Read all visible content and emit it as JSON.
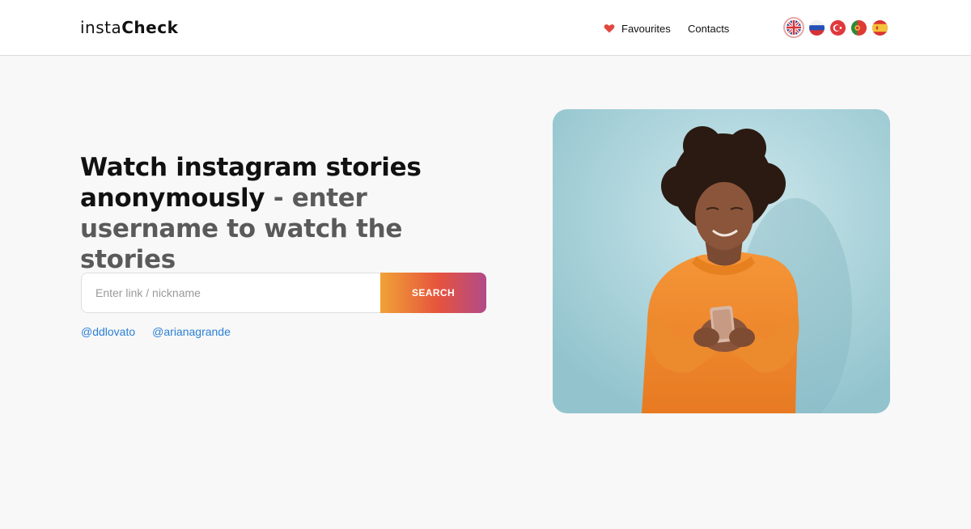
{
  "header": {
    "logo_light": "insta",
    "logo_bold": "Check",
    "nav": {
      "favourites_label": "Favourites",
      "contacts_label": "Contacts"
    },
    "languages": [
      {
        "name": "english-flag-icon",
        "active": true
      },
      {
        "name": "russian-flag-icon",
        "active": false
      },
      {
        "name": "turkish-flag-icon",
        "active": false
      },
      {
        "name": "portuguese-flag-icon",
        "active": false
      },
      {
        "name": "spanish-flag-icon",
        "active": false
      }
    ]
  },
  "hero": {
    "headline_strong": "Watch instagram stories anonymously",
    "headline_rest": " - enter username to watch the stories",
    "search": {
      "placeholder": "Enter link / nickname",
      "value": "",
      "button_label": "SEARCH"
    },
    "suggestions": [
      "@ddlovato",
      "@arianagrande"
    ]
  },
  "colors": {
    "accent_gradient_start": "#f0a236",
    "accent_gradient_mid": "#e6533d",
    "accent_gradient_end": "#b14a8a",
    "link": "#2b7fd6",
    "heart": "#e0483f"
  },
  "icons": {
    "favourites": "heart-icon"
  }
}
